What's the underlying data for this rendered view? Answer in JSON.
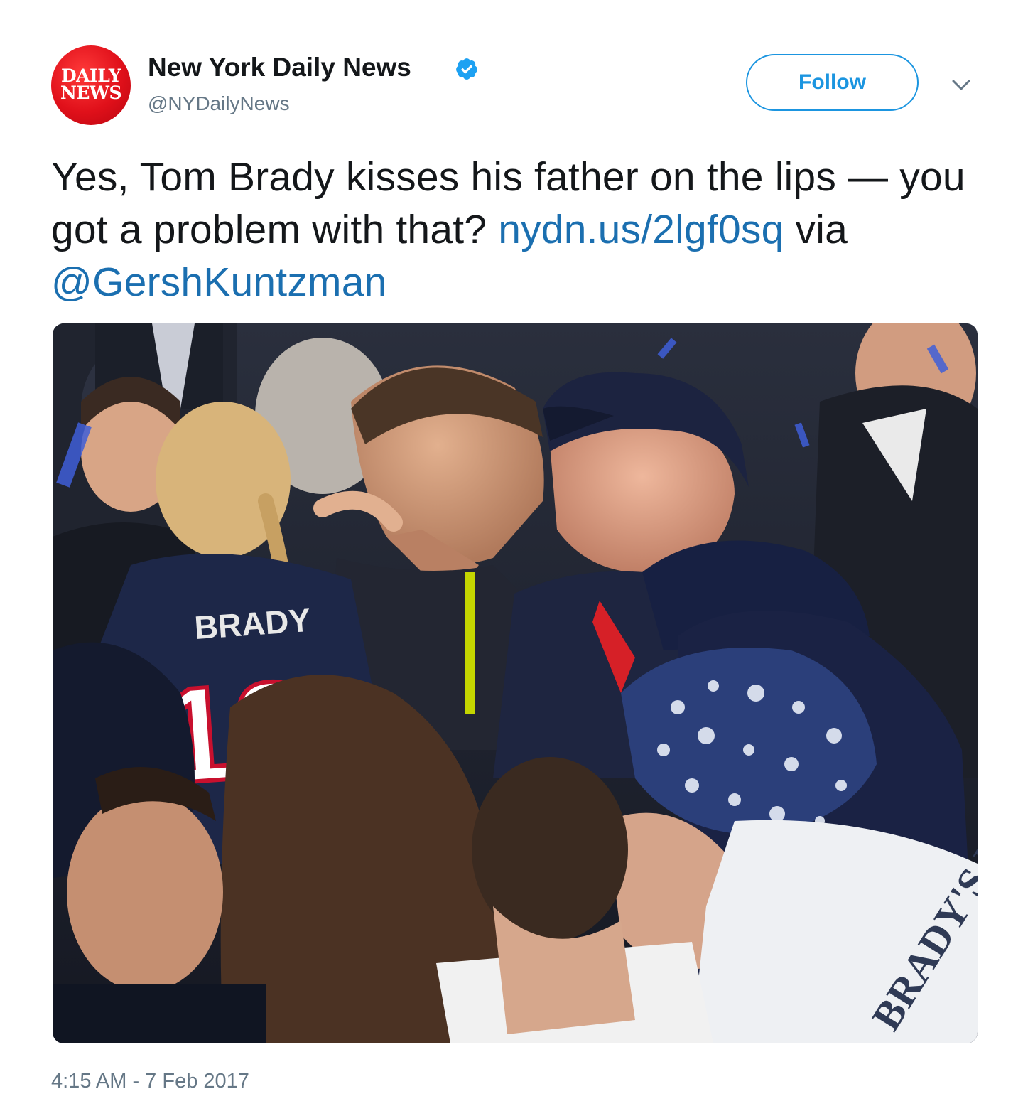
{
  "account": {
    "avatar_text_line1": "DAILY",
    "avatar_text_line2": "NEWS",
    "display_name": "New York Daily News",
    "handle": "@NYDailyNews",
    "verified": true
  },
  "actions": {
    "follow_label": "Follow",
    "menu_icon": "chevron-down-icon"
  },
  "tweet": {
    "text_part1": "Yes, Tom Brady kisses his father on the lips — you got a problem with that? ",
    "link": "nydn.us/2lgf0sq",
    "text_part2": " via ",
    "mention": "@GershKuntzman"
  },
  "media": {
    "jersey_name": "BRADY",
    "jersey_number": "12",
    "shirt_text": "BRADY'S LA"
  },
  "timestamp": "4:15 AM - 7 Feb 2017",
  "colors": {
    "link": "#1b6fb0",
    "follow": "#1b95e0",
    "verified": "#1da1f2",
    "muted": "#657786",
    "avatar_red": "#e0101a"
  }
}
